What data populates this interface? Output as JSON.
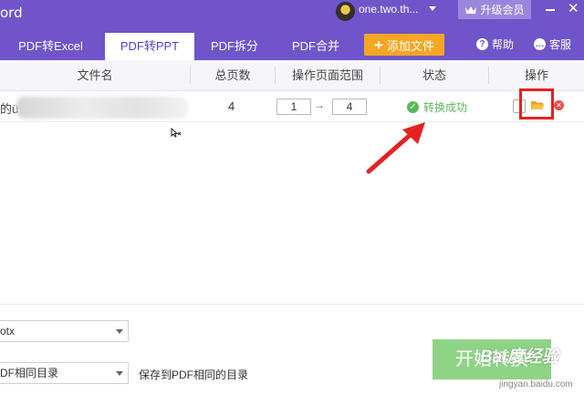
{
  "app": {
    "title": "ord"
  },
  "user": {
    "name": "one.two.th...",
    "vip_label": "升级会员"
  },
  "window": {
    "close_glyph": "✕"
  },
  "tabs": [
    {
      "label": "PDF转Excel"
    },
    {
      "label": "PDF转PPT",
      "active": true
    },
    {
      "label": "PDF拆分"
    },
    {
      "label": "PDF合并"
    }
  ],
  "toolbar": {
    "add_file": "添加文件",
    "help": "帮助",
    "service": "客服"
  },
  "table": {
    "headers": [
      "文件名",
      "总页数",
      "操作页面范围",
      "状态",
      "操作"
    ],
    "row": {
      "name": "的ü",
      "pages": "4",
      "range_from": "1",
      "range_to": "4",
      "range_arrow": "→",
      "status": "转换成功"
    }
  },
  "settings": {
    "format_value": "otx",
    "output_value": "DF相同目录",
    "output_desc": "保存到PDF相同的目录"
  },
  "start_button": {
    "label": "开始转换"
  },
  "watermark": {
    "text": "Bai度经验",
    "sub": "jingyan.baidu.com"
  },
  "colors": {
    "header_purple": "#6f55c9",
    "accent_orange": "#f5a623",
    "success_green": "#5cb85c",
    "annotation_red": "#e52222"
  },
  "icons": [
    "avatar",
    "crown-icon",
    "minimize-icon",
    "close-icon",
    "help-icon",
    "service-icon",
    "check-circle-icon",
    "open-file-icon",
    "folder-icon",
    "delete-icon",
    "cursor-icon",
    "arrow-annotation"
  ]
}
